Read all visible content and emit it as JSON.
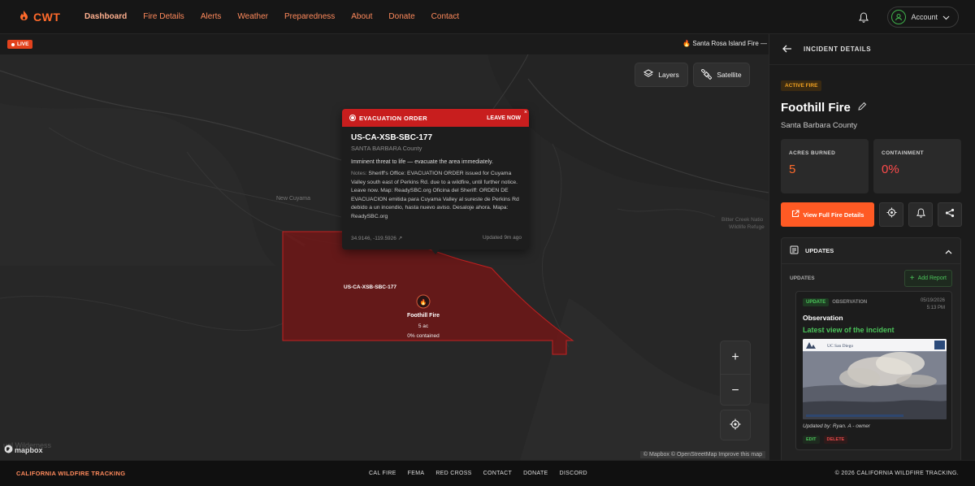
{
  "brand": {
    "logo_text": "CWT",
    "logo_icon": "flame-icon"
  },
  "nav": {
    "links": [
      "Dashboard",
      "Fire Details",
      "Alerts",
      "Weather",
      "Preparedness",
      "About",
      "Donate",
      "Contact"
    ],
    "active": "Dashboard",
    "account_label": "Account"
  },
  "map": {
    "live_label": "LIVE",
    "ticker": "Santa Rosa Island Fire —",
    "layers_label": "Layers",
    "satellite_label": "Satellite",
    "place_labels": [
      "New Cuyama",
      "Bitter Creek Natio",
      "Wildlife Refuge",
      "ual Wilderness"
    ],
    "zone_label": "US-CA-XSB-SBC-177",
    "fire_marker": {
      "name": "Foothill Fire",
      "acres": "5 ac",
      "contained": "0% contained"
    },
    "attribution": "© Mapbox © OpenStreetMap Improve this map",
    "mapbox_logo": "mapbox",
    "colors": {
      "zone_fill": "#6b1818",
      "zone_stroke": "#c42020"
    }
  },
  "popup": {
    "title": "EVACUATION ORDER",
    "action": "LEAVE NOW",
    "close": "×",
    "zone_id": "US-CA-XSB-SBC-177",
    "county": "SANTA BARBARA County",
    "threat": "Imminent threat to life — evacuate the area immediately.",
    "notes_label": "Notes:",
    "notes": "Sheriff's Office: EVACUATION ORDER issued for Cuyama Valley south east of Perkins Rd. due to a wildfire, until further notice. Leave now. Map: ReadySBC.org Oficina del Sheriff: ORDEN DE EVACUACION emitida para Cuyama Valley al sureste de Perkins Rd debido a un incendio, hasta nuevo aviso. Desaloje ahora. Mapa: ReadySBC.org",
    "coords": "34.9146, -119.5926 ↗",
    "updated": "Updated 9m ago"
  },
  "panel": {
    "header": "INCIDENT DETAILS",
    "status": "ACTIVE FIRE",
    "fire_name": "Foothill Fire",
    "county": "Santa Barbara County",
    "acres_label": "ACRES BURNED",
    "acres_value": "5",
    "containment_label": "CONTAINMENT",
    "containment_value": "0%",
    "full_details_label": "View Full Fire Details",
    "updates": {
      "title": "UPDATES",
      "subheading": "UPDATES",
      "add_report": "Add Report",
      "card": {
        "tag_update": "UPDATE",
        "tag_type": "OBSERVATION",
        "date": "05/19/2026",
        "time": "5:13 PM",
        "title": "Observation",
        "subtitle": "Latest view of the incident",
        "updated_by": "Updated by: Ryan. A - owner",
        "edit": "EDIT",
        "delete": "DELETE",
        "camera_label": "UC San Diego"
      }
    }
  },
  "footer": {
    "brand": "CALIFORNIA WILDFIRE TRACKING",
    "links": [
      "CAL FIRE",
      "FEMA",
      "RED CROSS",
      "CONTACT",
      "DONATE",
      "DISCORD"
    ],
    "copyright": "© 2026 CALIFORNIA WILDFIRE TRACKING."
  },
  "colors": {
    "accent": "#ff6a2b",
    "danger": "#c81e1e",
    "success": "#4bc45a"
  }
}
